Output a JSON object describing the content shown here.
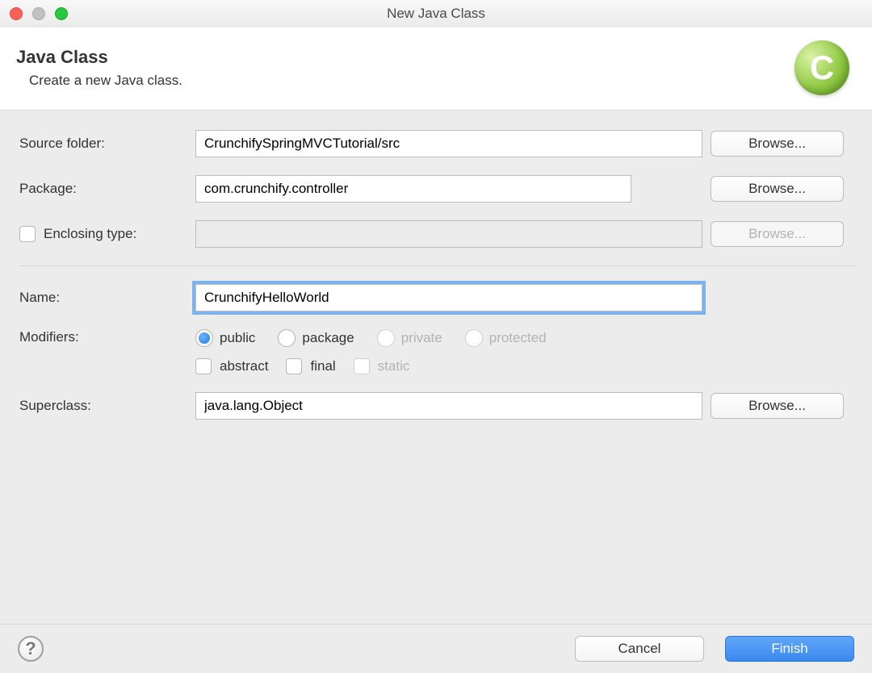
{
  "window": {
    "title": "New Java Class"
  },
  "header": {
    "heading": "Java Class",
    "subtitle": "Create a new Java class.",
    "icon_letter": "C"
  },
  "form": {
    "source_folder": {
      "label": "Source folder:",
      "value": "CrunchifySpringMVCTutorial/src",
      "browse": "Browse..."
    },
    "package": {
      "label": "Package:",
      "value": "com.crunchify.controller",
      "browse": "Browse..."
    },
    "enclosing": {
      "label": "Enclosing type:",
      "value": "",
      "browse": "Browse..."
    },
    "name": {
      "label": "Name:",
      "value": "CrunchifyHelloWorld"
    },
    "modifiers": {
      "label": "Modifiers:",
      "public": "public",
      "package": "package",
      "private": "private",
      "protected": "protected",
      "abstract": "abstract",
      "final": "final",
      "static": "static"
    },
    "superclass": {
      "label": "Superclass:",
      "value": "java.lang.Object",
      "browse": "Browse..."
    }
  },
  "footer": {
    "help": "?",
    "cancel": "Cancel",
    "finish": "Finish"
  }
}
